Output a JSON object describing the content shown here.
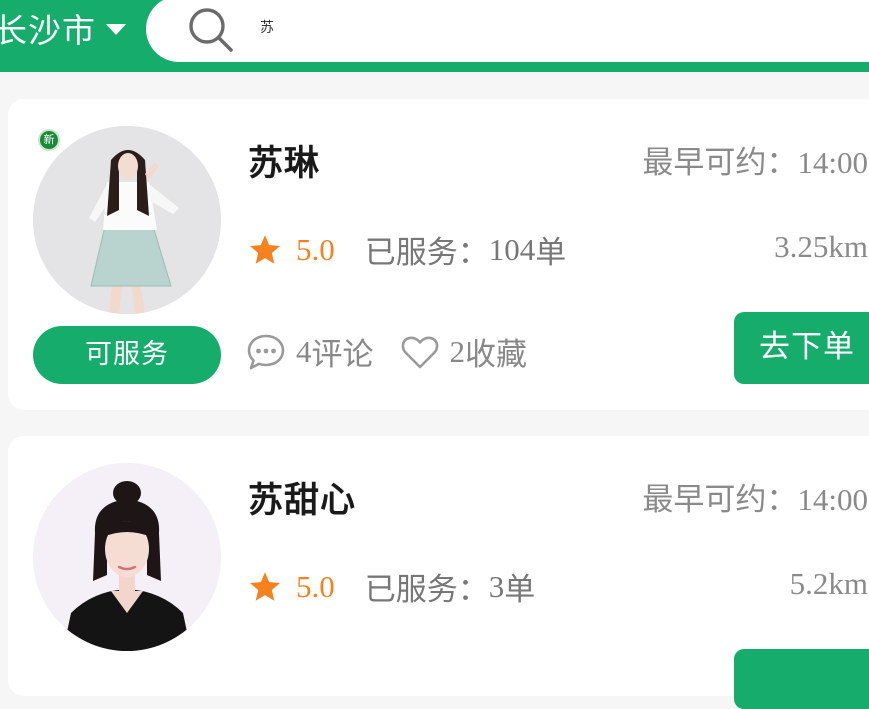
{
  "header": {
    "city": "长沙市",
    "search_value": "苏"
  },
  "providers": [
    {
      "badge": "新",
      "name": "苏琳",
      "earliest_label": "最早可约：",
      "earliest_time": "14:00",
      "rating": "5.0",
      "served_label": "已服务：",
      "served_count": "104",
      "served_unit": "单",
      "distance": "3.25km",
      "status": "可服务",
      "comments_count": "4",
      "comments_label": "评论",
      "favorites_count": "2",
      "favorites_label": "收藏",
      "order_label": "去下单"
    },
    {
      "name": "苏甜心",
      "earliest_label": "最早可约：",
      "earliest_time": "14:00",
      "rating": "5.0",
      "served_label": "已服务：",
      "served_count": "3",
      "served_unit": "单",
      "distance": "5.2km"
    }
  ],
  "colors": {
    "brand_green": "#16ad6c",
    "rating_orange": "#f5821f",
    "muted_text": "#8a8a8a"
  },
  "icons": [
    "search-icon",
    "caret-down-icon",
    "star-icon",
    "comment-icon",
    "heart-icon",
    "new-badge-icon"
  ]
}
